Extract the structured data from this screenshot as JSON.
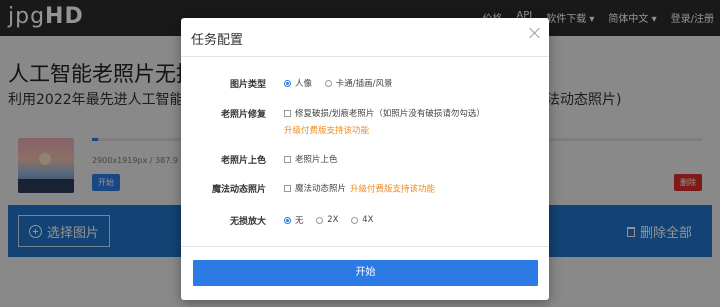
{
  "header": {
    "logo_thin": "jpg",
    "logo_bold": "HD",
    "nav": [
      {
        "label": "价格"
      },
      {
        "label": "API"
      },
      {
        "label": "软件下载 ▾"
      },
      {
        "label": "简体中文 ▾"
      },
      {
        "label": "登录/注册"
      }
    ]
  },
  "hero": {
    "title": "人工智能老照片无损",
    "subtitle": "利用2022年最先进人工智能 A",
    "subtitle_right": "法动态照片)"
  },
  "upload": {
    "file_info": "2900x1919px / 387.9 KB",
    "progress_percent": 1,
    "start_label": "开始",
    "delete_label": "删除"
  },
  "bottom_bar": {
    "select_label": "选择图片",
    "delete_all_label": "删除全部"
  },
  "modal": {
    "title": "任务配置",
    "rows": {
      "image_type": {
        "label": "图片类型",
        "options": [
          {
            "label": "人像",
            "checked": true
          },
          {
            "label": "卡通/插画/风景",
            "checked": false
          }
        ]
      },
      "repair": {
        "label": "老照片修复",
        "option": "修复破损/划痕老照片（如照片没有破损请勿勾选）",
        "upgrade": "升级付费版支持该功能"
      },
      "colorize": {
        "label": "老照片上色",
        "option": "老照片上色"
      },
      "animate": {
        "label": "魔法动态照片",
        "option": "魔法动态照片",
        "upgrade": "升级付费版支持该功能"
      },
      "upscale": {
        "label": "无损放大",
        "options": [
          {
            "label": "无",
            "checked": true
          },
          {
            "label": "2X",
            "checked": false
          },
          {
            "label": "4X",
            "checked": false
          }
        ]
      }
    },
    "start_label": "开始"
  },
  "colors": {
    "accent": "#2c7be5",
    "bar_blue": "#2173c8",
    "danger": "#d9302c",
    "upgrade_orange": "#f08a1d",
    "topbar": "#2b2b2b"
  }
}
